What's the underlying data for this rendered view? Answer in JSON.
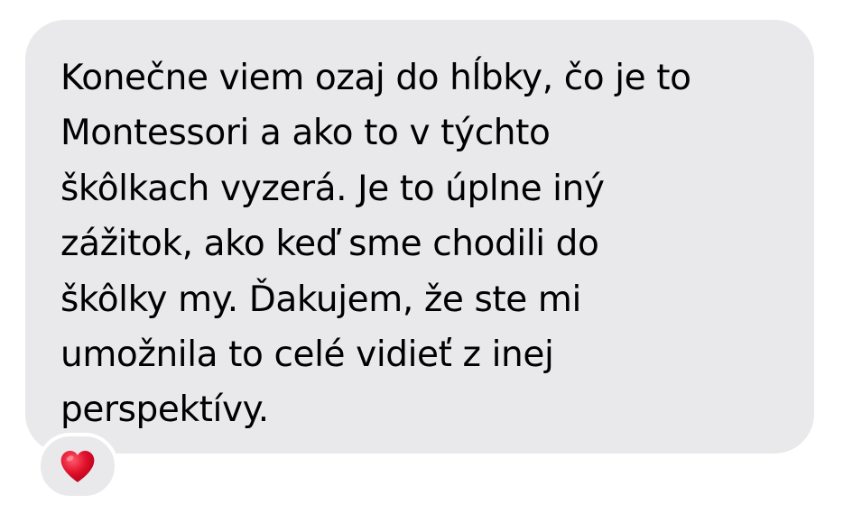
{
  "message": {
    "lines": [
      "Konečne viem ozaj do hĺbky, čo je to",
      "Montessori a ako to v týchto",
      "škôlkach vyzerá. Je to úplne iný",
      "zážitok, ako keď sme chodili do",
      "škôlky my. Ďakujem, že ste mi",
      "umožnila to celé vidieť z inej",
      "perspektívy."
    ]
  },
  "reaction": {
    "icon": "heart-icon",
    "color": "#e0102a"
  },
  "colors": {
    "bubble": "#e9e9eb",
    "text": "#000000",
    "background": "#ffffff"
  }
}
